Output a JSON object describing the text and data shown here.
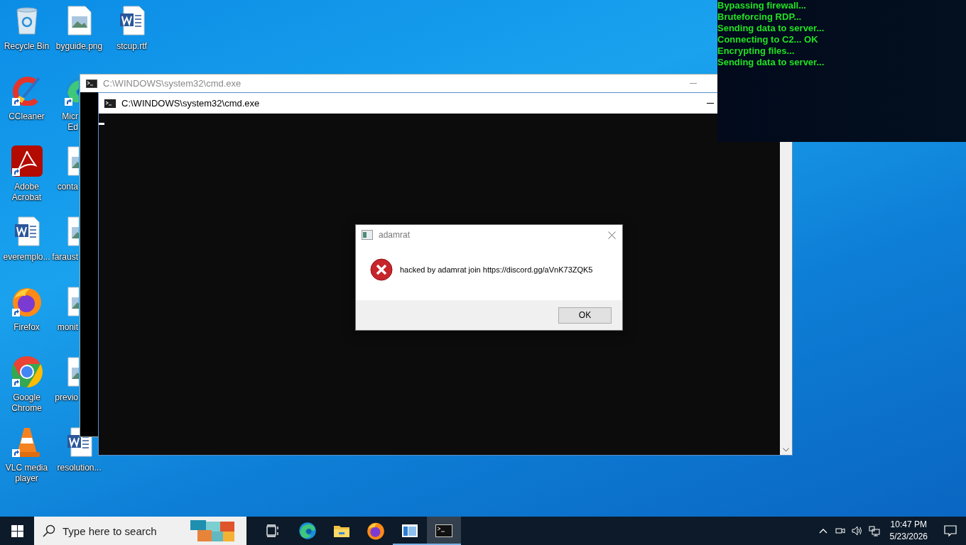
{
  "desktop": {
    "icons": [
      {
        "kind": "recycle-bin",
        "lines": [
          "Recycle Bin"
        ],
        "shortcut": false,
        "cut": false
      },
      {
        "kind": "image",
        "lines": [
          "byguide.png"
        ],
        "shortcut": false,
        "cut": false
      },
      {
        "kind": "document",
        "lines": [
          "stcup.rtf"
        ],
        "shortcut": false,
        "cut": false
      },
      {
        "kind": "ccleaner",
        "lines": [
          "CCleaner"
        ],
        "shortcut": true,
        "cut": false
      },
      {
        "kind": "edge",
        "lines": [
          "Micr",
          "Ed"
        ],
        "shortcut": true,
        "cut": true
      },
      {
        "kind": "acrobat",
        "lines": [
          "Adobe",
          "Acrobat"
        ],
        "shortcut": true,
        "cut": false
      },
      {
        "kind": "image",
        "lines": [
          "conta"
        ],
        "shortcut": false,
        "cut": true
      },
      {
        "kind": "document",
        "lines": [
          "everemplo..."
        ],
        "shortcut": false,
        "cut": false
      },
      {
        "kind": "image",
        "lines": [
          "faraust"
        ],
        "shortcut": false,
        "cut": true
      },
      {
        "kind": "firefox",
        "lines": [
          "Firefox"
        ],
        "shortcut": true,
        "cut": false
      },
      {
        "kind": "image",
        "lines": [
          "monit"
        ],
        "shortcut": false,
        "cut": true
      },
      {
        "kind": "chrome",
        "lines": [
          "Google",
          "Chrome"
        ],
        "shortcut": true,
        "cut": false
      },
      {
        "kind": "image",
        "lines": [
          "previo"
        ],
        "shortcut": false,
        "cut": true
      },
      {
        "kind": "vlc",
        "lines": [
          "VLC media",
          "player"
        ],
        "shortcut": true,
        "cut": false
      },
      {
        "kind": "document",
        "lines": [
          "resolution..."
        ],
        "shortcut": false,
        "cut": false
      }
    ]
  },
  "windows": [
    {
      "title": "C:\\WINDOWS\\system32\\cmd.exe",
      "active": false
    },
    {
      "title": "C:\\WINDOWS\\system32\\cmd.exe",
      "active": true
    }
  ],
  "dialog": {
    "title": "adamrat",
    "message": "hacked by adamrat join https://discord.gg/aVnK73ZQK5",
    "button": "OK"
  },
  "log": [
    "Bypassing firewall...",
    "Bruteforcing RDP...",
    "Sending data to server...",
    "Connecting to C2... OK",
    "Encrypting files...",
    "Sending data to server..."
  ],
  "taskbar": {
    "search": {
      "placeholder": "Type here to search"
    },
    "apps": [
      {
        "kind": "task-view",
        "running": false,
        "selected": false
      },
      {
        "kind": "edge",
        "running": false,
        "selected": false
      },
      {
        "kind": "explorer",
        "running": false,
        "selected": false
      },
      {
        "kind": "firefox",
        "running": false,
        "selected": false
      },
      {
        "kind": "app",
        "running": true,
        "selected": false
      },
      {
        "kind": "cmd",
        "running": true,
        "selected": true
      }
    ],
    "time": "10:47 PM",
    "date": "5/23/2026"
  }
}
